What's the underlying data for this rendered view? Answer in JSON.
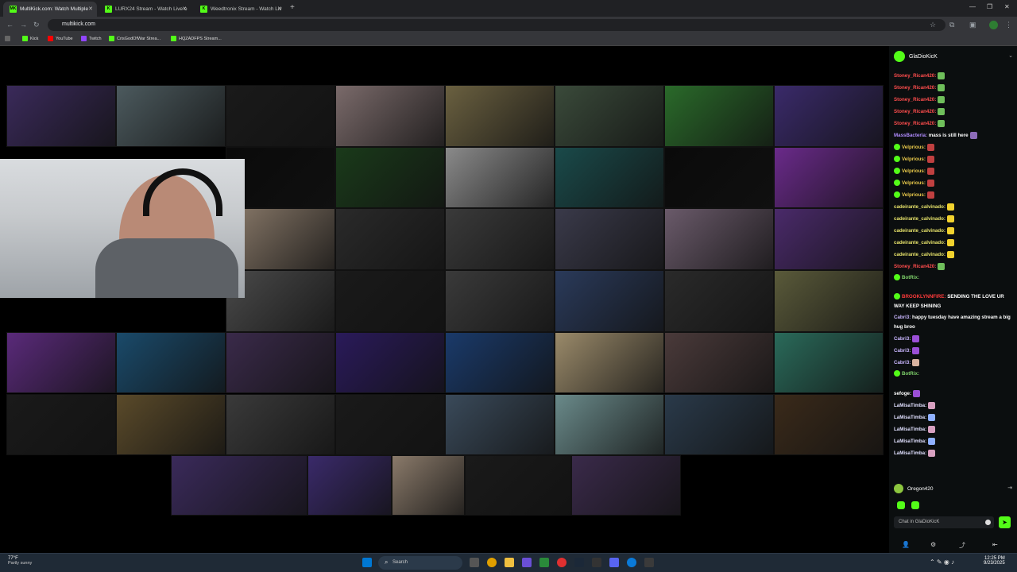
{
  "browser": {
    "tabs": [
      {
        "label": "MultiKick.com: Watch Multiple",
        "favicon": "MK",
        "active": true
      },
      {
        "label": "LURX24 Stream - Watch Live o",
        "favicon": "K",
        "active": false
      },
      {
        "label": "Weedtronix Stream - Watch Liv",
        "favicon": "K",
        "active": false
      }
    ],
    "new_tab": "+",
    "url": "multikick.com",
    "bookmarks": [
      "Kick",
      "YouTube",
      "Twitch",
      "CrisGodOfWar Strea...",
      "HQZADFPS Stream..."
    ]
  },
  "chat": {
    "channel": "GlaDioKicK",
    "messages": [
      {
        "user": "Stoney_Rican420:",
        "text": "",
        "color": "#ff4d4d",
        "emote": "#6fbf5b"
      },
      {
        "user": "Stoney_Rican420:",
        "text": "",
        "color": "#ff4d4d",
        "emote": "#6fbf5b"
      },
      {
        "user": "Stoney_Rican420:",
        "text": "",
        "color": "#ff4d4d",
        "emote": "#6fbf5b"
      },
      {
        "user": "Stoney_Rican420:",
        "text": "",
        "color": "#ff4d4d",
        "emote": "#6fbf5b"
      },
      {
        "user": "Stoney_Rican420:",
        "text": "",
        "color": "#ff4d4d",
        "emote": "#6fbf5b"
      },
      {
        "user": "MassBacteria:",
        "text": "mass is still here",
        "color": "#b18cff",
        "emote": "#8c6bb8"
      },
      {
        "user": "Velprious:",
        "text": "",
        "color": "#e8c84a",
        "emote": "#c04040",
        "badge": true
      },
      {
        "user": "Velprious:",
        "text": "",
        "color": "#e8c84a",
        "emote": "#c04040",
        "badge": true
      },
      {
        "user": "Velprious:",
        "text": "",
        "color": "#e8c84a",
        "emote": "#c04040",
        "badge": true
      },
      {
        "user": "Velprious:",
        "text": "",
        "color": "#e8c84a",
        "emote": "#c04040",
        "badge": true
      },
      {
        "user": "Velprious:",
        "text": "",
        "color": "#e8c84a",
        "emote": "#c04040",
        "badge": true
      },
      {
        "user": "cadeirante_calvinado:",
        "text": "",
        "color": "#e6e26a",
        "emote": "#f2d22e"
      },
      {
        "user": "cadeirante_calvinado:",
        "text": "",
        "color": "#e6e26a",
        "emote": "#f2d22e"
      },
      {
        "user": "cadeirante_calvinado:",
        "text": "",
        "color": "#e6e26a",
        "emote": "#f2d22e"
      },
      {
        "user": "cadeirante_calvinado:",
        "text": "",
        "color": "#e6e26a",
        "emote": "#f2d22e"
      },
      {
        "user": "cadeirante_calvinado:",
        "text": "",
        "color": "#e6e26a",
        "emote": "#f2d22e"
      },
      {
        "user": "Stoney_Rican420:",
        "text": "",
        "color": "#ff4d4d",
        "emote": "#6fbf5b"
      },
      {
        "user": "BotRix:",
        "text": "",
        "color": "#7fd36b",
        "badge": true,
        "wrap": true,
        "lines": 2
      },
      {
        "user": "BROOKLYNNFIRE:",
        "text": "SENDING THE LOVE UR WAY KEEP SHINING",
        "color": "#ff3b3b",
        "badge": true,
        "wrap": true
      },
      {
        "user": "Cabri3:",
        "text": "happy tuesday have amazing stream a big hug broo",
        "color": "#c9b6ff",
        "wrap": true
      },
      {
        "user": "Cabri3:",
        "text": "",
        "color": "#c9b6ff",
        "emote": "#9a4fd6"
      },
      {
        "user": "Cabri3:",
        "text": "",
        "color": "#c9b6ff",
        "emote": "#9a4fd6"
      },
      {
        "user": "Cabri3:",
        "text": "",
        "color": "#c9b6ff",
        "emote": "#d9b3a0"
      },
      {
        "user": "BotRix:",
        "text": "",
        "color": "#7fd36b",
        "badge": true,
        "wrap": true,
        "lines": 2
      },
      {
        "user": "sefoge:",
        "text": "",
        "color": "#ffffff",
        "emote": "#9a4fd6"
      },
      {
        "user": "LaMisaTimba:",
        "text": "",
        "color": "#e0e0ff",
        "emote": "#d7a0c0"
      },
      {
        "user": "LaMisaTimba:",
        "text": "",
        "color": "#e0e0ff",
        "emote": "#8fb0ff"
      },
      {
        "user": "LaMisaTimba:",
        "text": "",
        "color": "#e0e0ff",
        "emote": "#d7a0c0"
      },
      {
        "user": "LaMisaTimba:",
        "text": "",
        "color": "#e0e0ff",
        "emote": "#8fb0ff"
      },
      {
        "user": "LaMisaTimba:",
        "text": "",
        "color": "#e0e0ff",
        "emote": "#d7a0c0"
      }
    ],
    "current_user": "Oregon420",
    "input_placeholder": "Chat in GlaDioKicK"
  },
  "taskbar": {
    "weather_temp": "77°F",
    "weather_desc": "Partly sunny",
    "search_placeholder": "Search",
    "time": "12:25 PM",
    "date": "9/23/2025"
  },
  "colors": {
    "accent": "#53fc18",
    "chat_bg": "#0b0e0f",
    "browser_bg": "#35363a"
  },
  "stream_tiles": [
    "#3a2a5a",
    "#4c5a5e",
    "#1a1a1a",
    "#7a6a6a",
    "#6a6040",
    "#3a4a3a",
    "#2a6a2a",
    "#3a2a6a",
    "#0a0a0a",
    "#1a3a1a",
    "#8a8a8a",
    "#1a4a4a",
    "#0a0a0a",
    "#6a2a8a",
    "#8a7a6a",
    "#2a2a2a",
    "#3a3a3a",
    "#3a3a4a",
    "#6a5a6a",
    "#4a2a6a",
    "#4a4a4a",
    "#1a1a1a",
    "#3a3a3a",
    "#2a3a5a",
    "#2a2a2a",
    "#5a5a3a",
    "#5a2a7a",
    "#1a4a6a",
    "#3a2a4a",
    "#2a1a5a",
    "#1a3a6a",
    "#9a8a6a",
    "#4a3a3a",
    "#2a6a5a",
    "#1a1a1a",
    "#5a4a2a",
    "#3a3a3a",
    "#1a1a1a",
    "#3a4a5a",
    "#6a8a8a",
    "#2a3a4a",
    "#3a2a1a",
    "#3a3a3a"
  ]
}
